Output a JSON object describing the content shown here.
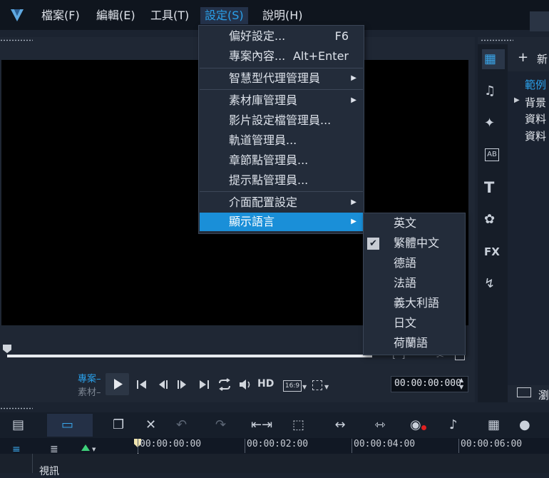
{
  "menubar": {
    "items": [
      {
        "label": "檔案(F)"
      },
      {
        "label": "編輯(E)"
      },
      {
        "label": "工具(T)"
      },
      {
        "label": "設定(S)"
      },
      {
        "label": "說明(H)"
      }
    ]
  },
  "settings_menu": {
    "items": [
      {
        "label": "偏好設定...",
        "shortcut": "F6"
      },
      {
        "label": "專案內容...",
        "shortcut": "Alt+Enter"
      },
      {
        "label": "智慧型代理管理員"
      },
      {
        "label": "素材庫管理員"
      },
      {
        "label": "影片設定檔管理員..."
      },
      {
        "label": "軌道管理員..."
      },
      {
        "label": "章節點管理員..."
      },
      {
        "label": "提示點管理員..."
      },
      {
        "label": "介面配置設定"
      },
      {
        "label": "顯示語言"
      }
    ]
  },
  "language_menu": {
    "items": [
      {
        "label": "英文",
        "checked": false
      },
      {
        "label": "繁體中文",
        "checked": true
      },
      {
        "label": "德語",
        "checked": false
      },
      {
        "label": "法語",
        "checked": false
      },
      {
        "label": "義大利語",
        "checked": false
      },
      {
        "label": "日文",
        "checked": false
      },
      {
        "label": "荷蘭語",
        "checked": false
      }
    ]
  },
  "library": {
    "new_label": "新",
    "items": [
      "範例",
      "背景",
      "資料",
      "資料"
    ],
    "browse_label": "瀏"
  },
  "playback": {
    "project_label": "專案",
    "clip_label": "素材",
    "hd_label": "HD",
    "aspect_label": "16:9",
    "timecode": "00:00:00:000"
  },
  "timeline": {
    "timecodes": [
      "00:00:00:00",
      "00:00:02:00",
      "00:00:04:00",
      "00:00:06:00"
    ],
    "track_label": "視訊"
  },
  "library_icons": [
    "media-icon",
    "audio-icon",
    "transition-icon",
    "title-icon",
    "text-icon",
    "graphics-icon",
    "fx-icon",
    "path-icon"
  ],
  "colors": {
    "accent": "#1a8fd8",
    "highlight_text": "#2aa0ea"
  }
}
